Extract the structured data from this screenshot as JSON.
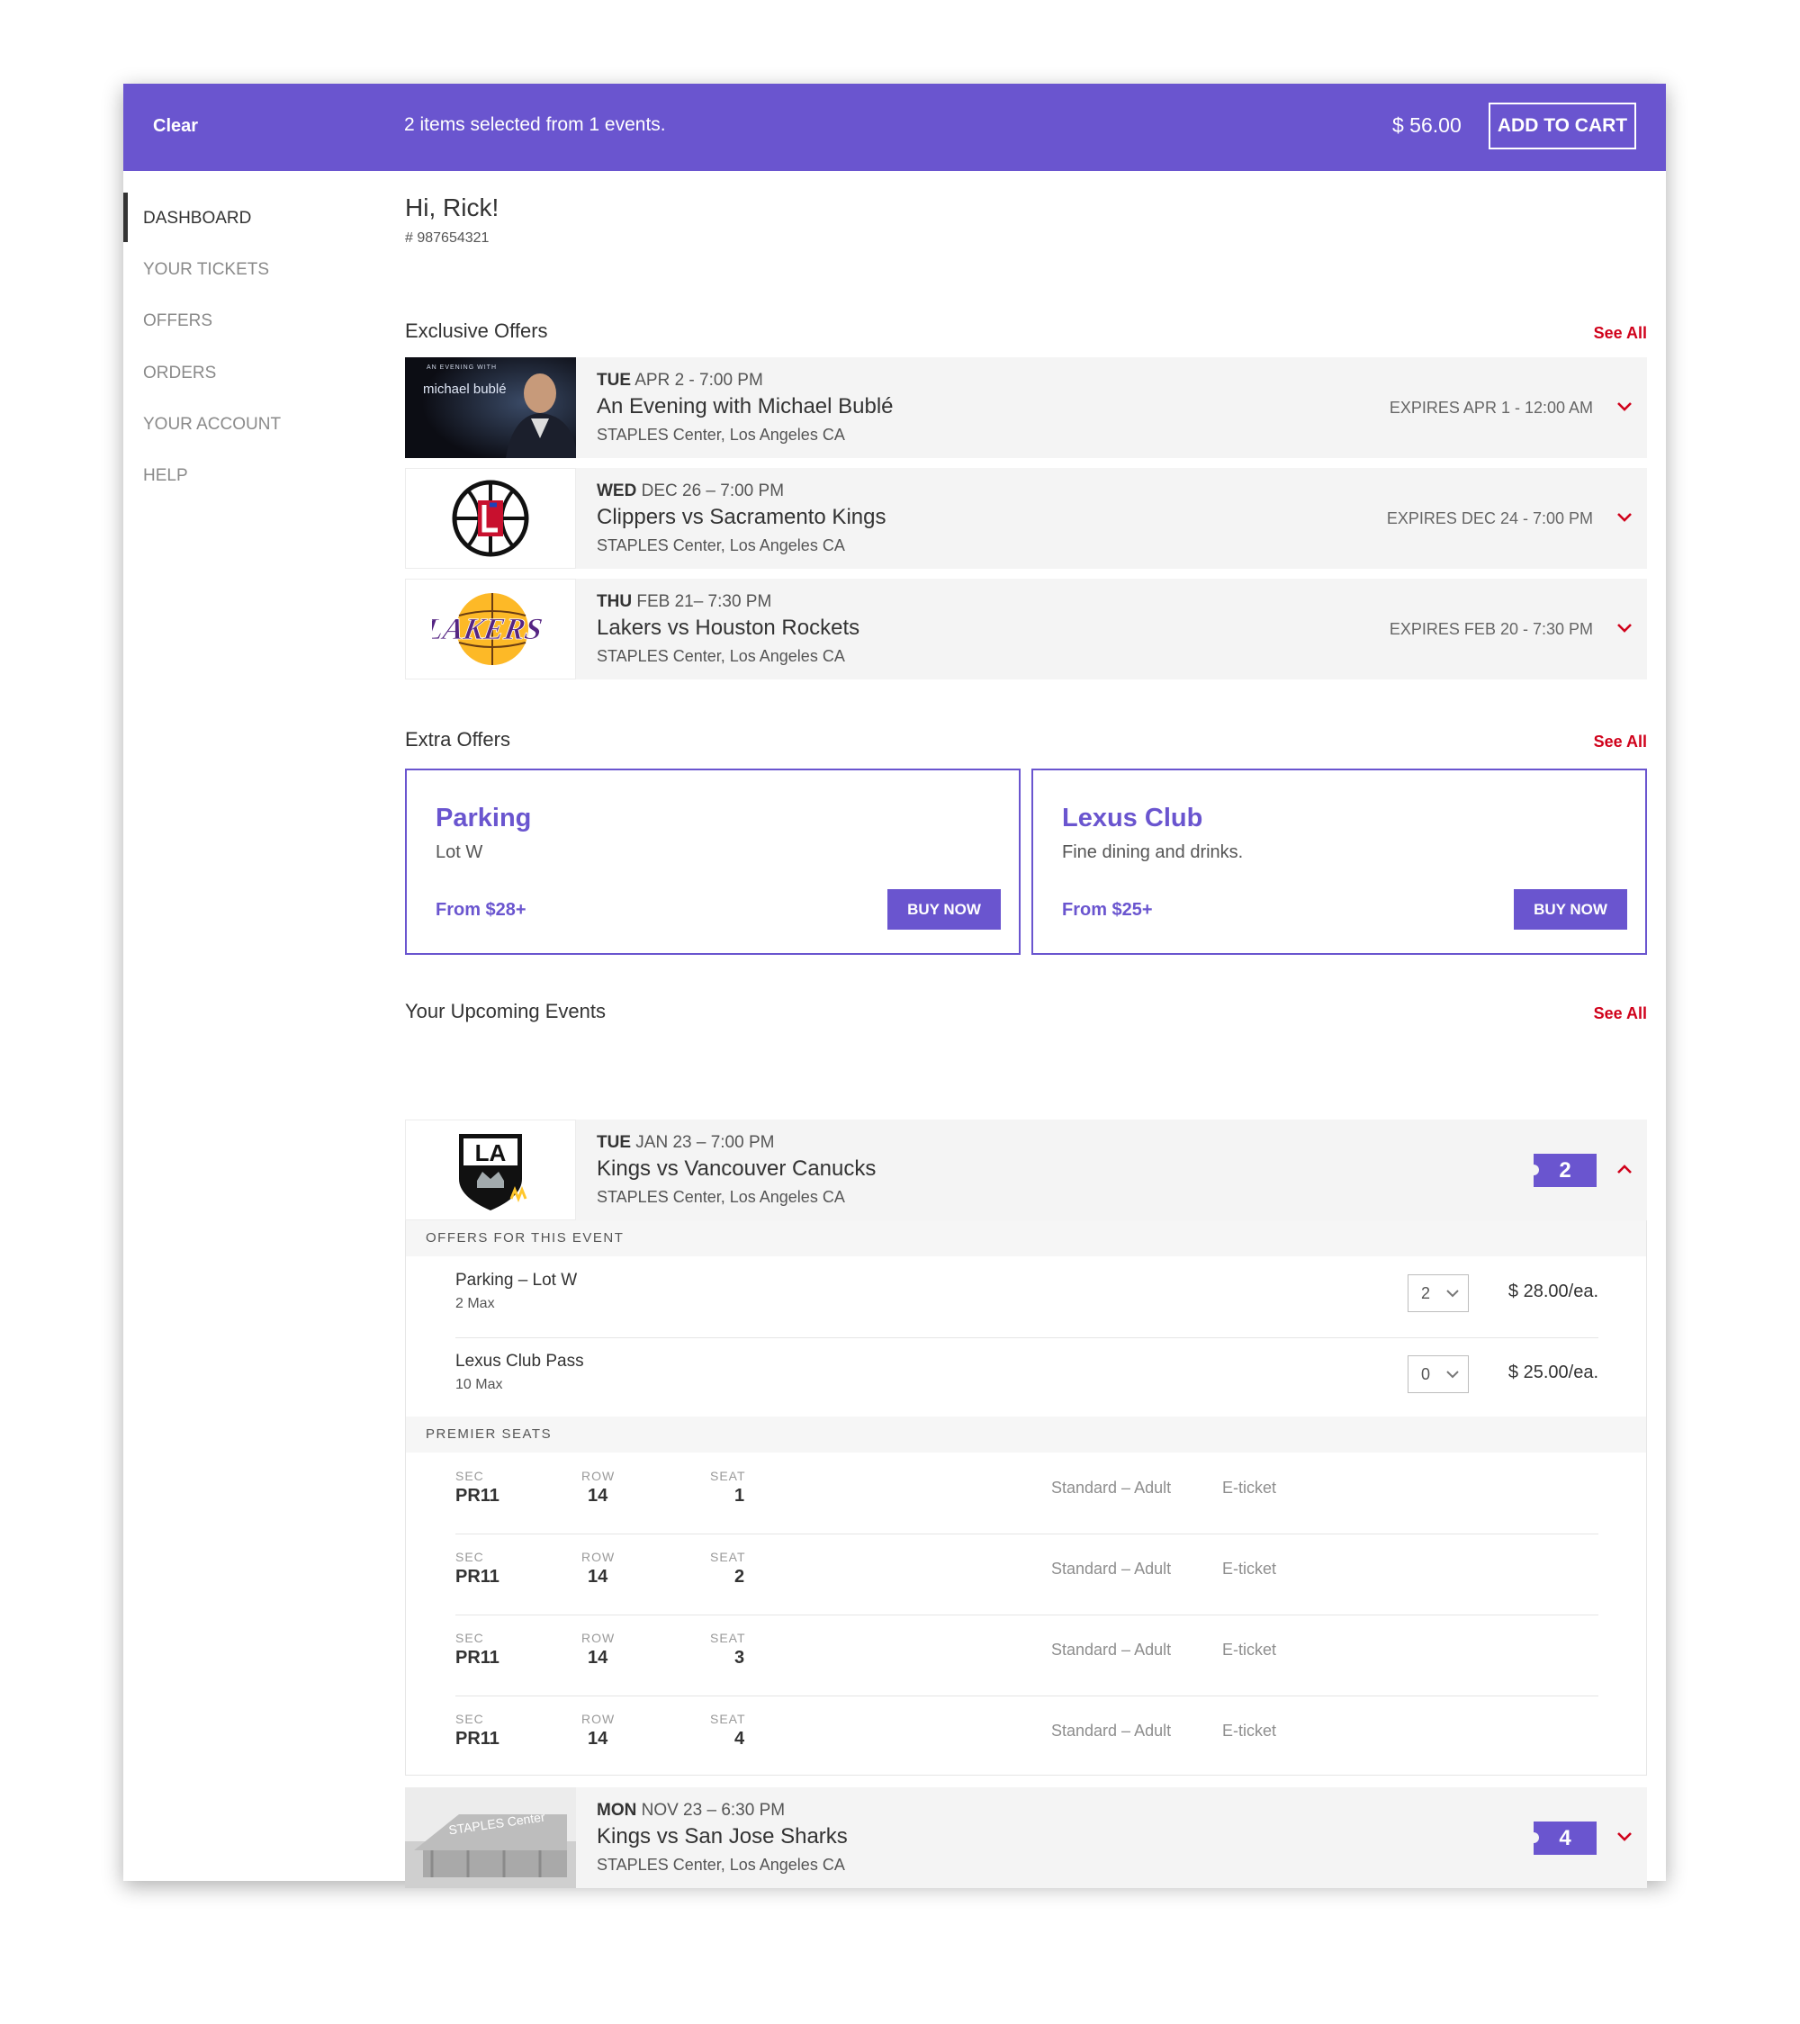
{
  "topbar": {
    "clear_label": "Clear",
    "summary": "2 items selected from 1 events.",
    "total": "$ 56.00",
    "add_to_cart": "ADD TO CART",
    "color": "#6a55cf"
  },
  "sidebar": {
    "items": [
      {
        "label": "DASHBOARD",
        "active": true
      },
      {
        "label": "YOUR TICKETS"
      },
      {
        "label": "OFFERS"
      },
      {
        "label": "ORDERS"
      },
      {
        "label": "YOUR ACCOUNT"
      },
      {
        "label": "HELP"
      }
    ]
  },
  "greeting": "Hi, Rick!",
  "account_number": "# 987654321",
  "see_all": "See All",
  "exclusive_offers": {
    "title": "Exclusive Offers",
    "events": [
      {
        "day": "TUE",
        "date": "APR 2 - 7:00 PM",
        "name": "An Evening with Michael Bublé",
        "venue": "STAPLES Center, Los Angeles CA",
        "expires": "EXPIRES APR 1 - 12:00 AM",
        "thumb_caption": "michael bublé",
        "thumb_small": "AN EVENING WITH",
        "icon": "concert-photo-icon"
      },
      {
        "day": "WED",
        "date": "DEC 26 – 7:00 PM",
        "name": "Clippers vs Sacramento Kings",
        "venue": "STAPLES Center, Los Angeles CA",
        "expires": "EXPIRES DEC 24 - 7:00 PM",
        "icon": "clippers-logo-icon"
      },
      {
        "day": "THU",
        "date": "FEB 21– 7:30 PM",
        "name": "Lakers vs Houston Rockets",
        "venue": "STAPLES Center, Los Angeles CA",
        "expires": "EXPIRES FEB 20 - 7:30 PM",
        "icon": "lakers-logo-icon"
      }
    ]
  },
  "extra_offers": {
    "title": "Extra Offers",
    "cards": [
      {
        "title": "Parking",
        "desc": "Lot W",
        "price": "From $28+",
        "button": "BUY NOW"
      },
      {
        "title": "Lexus Club",
        "desc": "Fine dining and drinks.",
        "price": "From $25+",
        "button": "BUY NOW"
      }
    ]
  },
  "upcoming": {
    "title": "Your Upcoming Events",
    "events": [
      {
        "day": "TUE",
        "date": "JAN 23 – 7:00 PM",
        "name": "Kings vs Vancouver Canucks",
        "venue": "STAPLES Center, Los Angeles CA",
        "count": "2",
        "expanded": true,
        "icon": "la-kings-logo-icon"
      },
      {
        "day": "MON",
        "date": "NOV 23 – 6:30 PM",
        "name": "Kings vs San Jose Sharks",
        "venue": "STAPLES Center, Los Angeles CA",
        "count": "4",
        "expanded": false,
        "icon": "staples-center-photo-icon",
        "thumb_caption": "STAPLES Center"
      }
    ],
    "offers_header": "OFFERS FOR THIS EVENT",
    "offers": [
      {
        "name": "Parking – Lot W",
        "max": "2 Max",
        "qty": "2",
        "price": "$ 28.00/ea."
      },
      {
        "name": "Lexus Club Pass",
        "max": "10 Max",
        "qty": "0",
        "price": "$ 25.00/ea."
      }
    ],
    "seats_header": "PREMIER SEATS",
    "seat_labels": {
      "sec": "SEC",
      "row": "ROW",
      "seat": "SEAT"
    },
    "seats": [
      {
        "sec": "PR11",
        "row": "14",
        "seat": "1",
        "type": "Standard – Adult",
        "delivery": "E-ticket"
      },
      {
        "sec": "PR11",
        "row": "14",
        "seat": "2",
        "type": "Standard – Adult",
        "delivery": "E-ticket"
      },
      {
        "sec": "PR11",
        "row": "14",
        "seat": "3",
        "type": "Standard – Adult",
        "delivery": "E-ticket"
      },
      {
        "sec": "PR11",
        "row": "14",
        "seat": "4",
        "type": "Standard – Adult",
        "delivery": "E-ticket"
      }
    ]
  },
  "colors": {
    "accent": "#6a55cf",
    "link_red": "#d0021b"
  }
}
